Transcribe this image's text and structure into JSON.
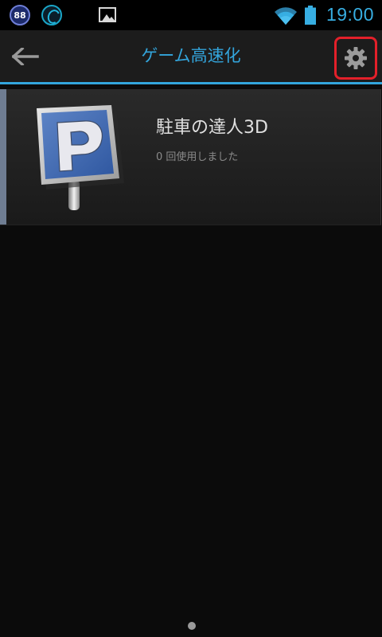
{
  "status_bar": {
    "badge_text": "88",
    "time": "19:00"
  },
  "action_bar": {
    "title": "ゲーム高速化"
  },
  "game_list": [
    {
      "name": "駐車の達人3D",
      "usage": "0 回使用しました",
      "icon": "parking-sign-icon"
    }
  ],
  "colors": {
    "accent_blue": "#33a5dc",
    "highlight_red": "#e3202a",
    "background": "#0b0b0b"
  }
}
